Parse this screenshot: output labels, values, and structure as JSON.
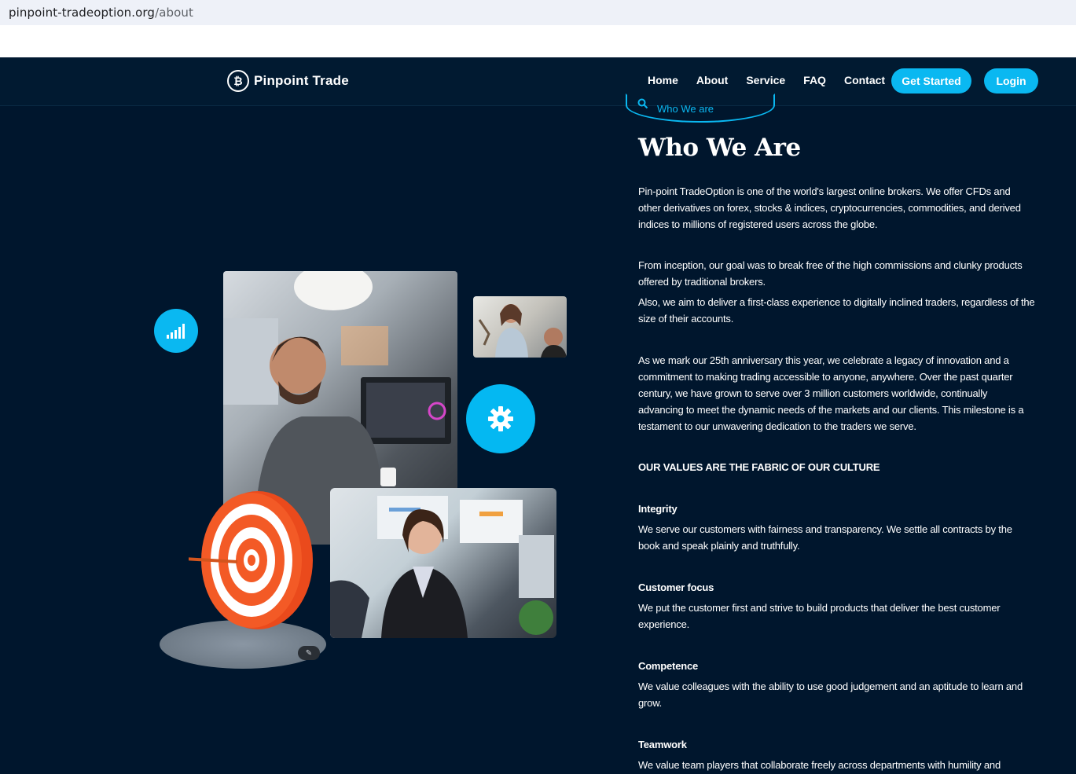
{
  "browser": {
    "url_domain": "pinpoint-tradeoption.org",
    "url_path": "/about"
  },
  "navbar": {
    "logo_text": "Pinpoint Trade",
    "logo_glyph": "₿",
    "items": [
      {
        "label": "Home"
      },
      {
        "label": "About"
      },
      {
        "label": "Service"
      },
      {
        "label": "FAQ"
      },
      {
        "label": "Contact"
      }
    ],
    "get_started_label": "Get Started",
    "login_label": "Login"
  },
  "about": {
    "tag_label": "Who We are",
    "title": "Who We Are",
    "paragraphs": [
      "Pin-point TradeOption is one of the world's largest online brokers. We offer CFDs and other derivatives on forex, stocks & indices, cryptocurrencies, commodities, and derived indices to millions of registered users across the globe.",
      "From inception, our goal was to break free of the high commissions and clunky products offered by traditional brokers.",
      "Also, we aim to deliver a first-class experience to digitally inclined traders, regardless of the size of their accounts.",
      "As we mark our 25th anniversary this year, we celebrate a legacy of innovation and a commitment to making trading accessible to anyone, anywhere. Over the past quarter century, we have grown to serve over 3 million customers worldwide, continually advancing to meet the dynamic needs of the markets and our clients. This milestone is a testament to our unwavering dedication to the traders we serve."
    ],
    "values_heading": "OUR VALUES ARE THE FABRIC OF OUR CULTURE",
    "values": [
      {
        "title": "Integrity",
        "text": "We serve our customers with fairness and transparency. We settle all contracts by the book and speak plainly and truthfully."
      },
      {
        "title": "Customer focus",
        "text": "We put the customer first and strive to build products that deliver the best customer experience."
      },
      {
        "title": "Competence",
        "text": "We value colleagues with the ability to use good judgement and an aptitude to learn and grow."
      },
      {
        "title": "Teamwork",
        "text": "We value team players that collaborate freely across departments with humility and"
      }
    ]
  },
  "colors": {
    "page_bg": "#00162d",
    "accent": "#0ab8f1",
    "text": "#ffffff"
  },
  "icons": {
    "signal": "signal-bars-icon",
    "gear": "gear-icon",
    "search": "search-icon",
    "magic": "magic-wand-icon"
  }
}
